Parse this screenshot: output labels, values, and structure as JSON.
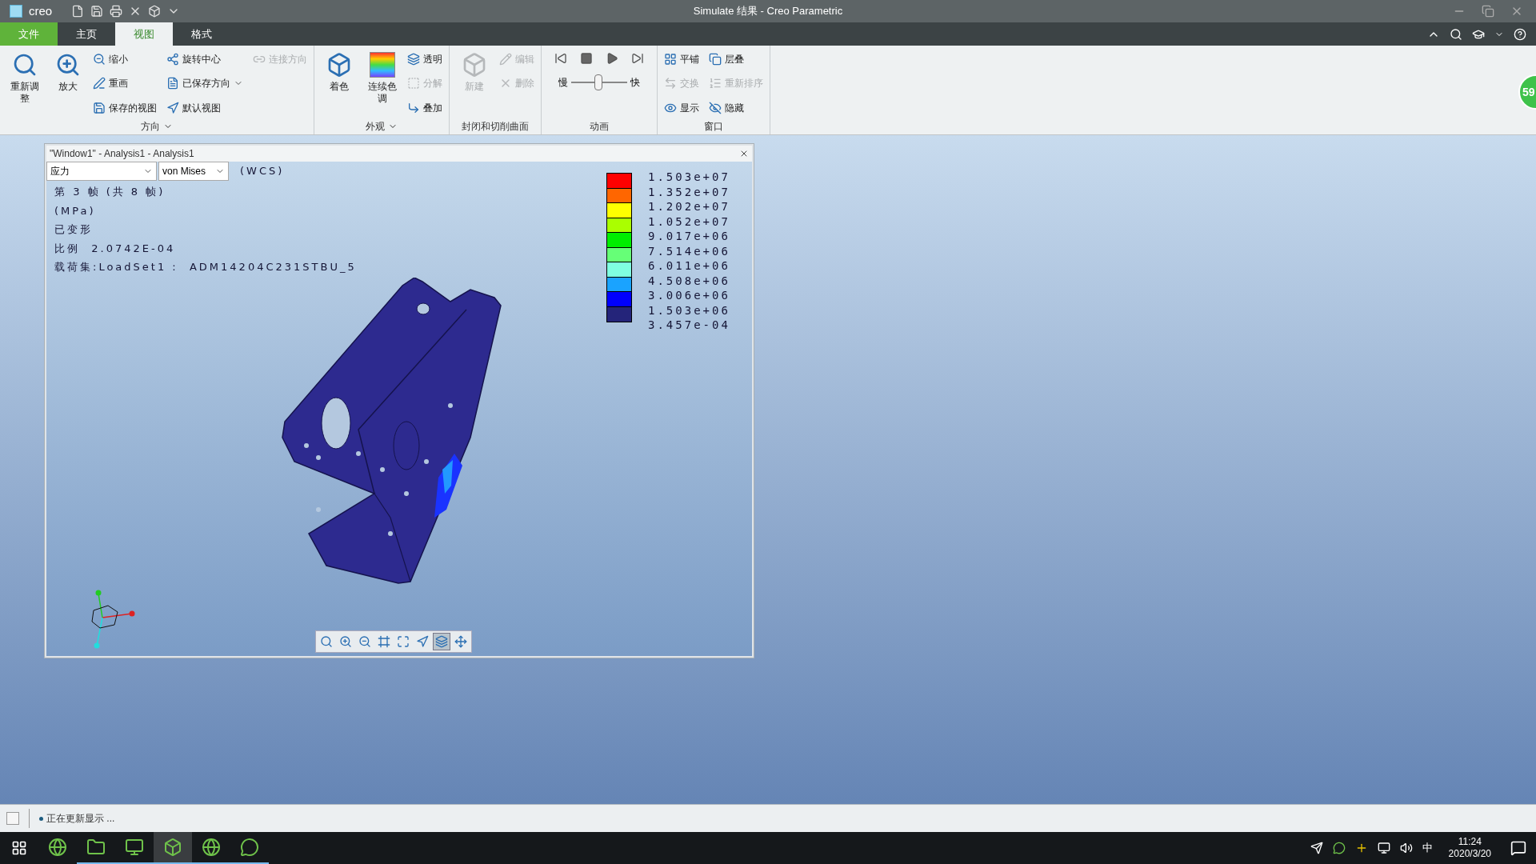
{
  "title_bar": {
    "app": "creo",
    "title": "Simulate 结果 - Creo Parametric"
  },
  "tabs": [
    {
      "label": "文件",
      "kind": "file",
      "selected": false
    },
    {
      "label": "主页",
      "kind": "tab",
      "selected": false
    },
    {
      "label": "视图",
      "kind": "tab",
      "selected": true
    },
    {
      "label": "格式",
      "kind": "tab",
      "selected": false
    }
  ],
  "ribbon_groups": [
    {
      "label": "方向",
      "dropdown": true,
      "items": [
        {
          "kind": "large",
          "label": "重新调整",
          "disabled": false
        },
        {
          "kind": "large",
          "label": "放大",
          "disabled": false
        },
        {
          "kind": "small",
          "label": "缩小",
          "disabled": false,
          "dropdown": false
        },
        {
          "kind": "small",
          "label": "重画",
          "disabled": false,
          "dropdown": false
        },
        {
          "kind": "small",
          "label": "保存的视图",
          "disabled": false,
          "dropdown": false
        },
        {
          "kind": "small",
          "label": "旋转中心",
          "disabled": false,
          "dropdown": false
        },
        {
          "kind": "small",
          "label": "已保存方向",
          "disabled": false,
          "dropdown": true
        },
        {
          "kind": "small",
          "label": "默认视图",
          "disabled": false,
          "dropdown": false
        },
        {
          "kind": "small",
          "label": "连接方向",
          "disabled": true,
          "dropdown": false
        }
      ]
    },
    {
      "label": "外观",
      "dropdown": true,
      "items": [
        {
          "kind": "large",
          "label": "着色",
          "disabled": false
        },
        {
          "kind": "large",
          "label": "连续色调",
          "disabled": false
        },
        {
          "kind": "small",
          "label": "透明",
          "disabled": false,
          "dropdown": false
        },
        {
          "kind": "small",
          "label": "分解",
          "disabled": true,
          "dropdown": false
        },
        {
          "kind": "small",
          "label": "叠加",
          "disabled": false,
          "dropdown": false
        }
      ]
    },
    {
      "label": "封闭和切削曲面",
      "dropdown": false,
      "items": [
        {
          "kind": "large",
          "label": "新建",
          "disabled": true
        },
        {
          "kind": "small",
          "label": "编辑",
          "disabled": true,
          "dropdown": false
        },
        {
          "kind": "small",
          "label": "删除",
          "disabled": true,
          "dropdown": false
        }
      ]
    },
    {
      "label": "动画",
      "dropdown": false,
      "items": [
        {
          "kind": "player",
          "slow": "慢",
          "fast": "快",
          "level": 0.48
        }
      ]
    },
    {
      "label": "窗口",
      "dropdown": false,
      "items": [
        {
          "kind": "small",
          "label": "平铺",
          "disabled": false,
          "dropdown": false
        },
        {
          "kind": "small",
          "label": "交换",
          "disabled": true,
          "dropdown": false
        },
        {
          "kind": "small",
          "label": "显示",
          "disabled": false,
          "dropdown": false
        },
        {
          "kind": "small",
          "label": "层叠",
          "disabled": false,
          "dropdown": false
        },
        {
          "kind": "small",
          "label": "重新排序",
          "disabled": true,
          "dropdown": false
        },
        {
          "kind": "small",
          "label": "隐藏",
          "disabled": false,
          "dropdown": false
        }
      ]
    }
  ],
  "badge": "59",
  "analysis_window": {
    "title": "\"Window1\" - Analysis1 - Analysis1",
    "quantity": "应力",
    "component": "von Mises",
    "coord_system": "(WCS)",
    "info_lines": [
      "第 3 帧 (共 8 帧)",
      "(MPa)",
      "已变形",
      "比例  2.0742E-04",
      "载荷集:LoadSet1 :  ADM14204C231STBU_5"
    ],
    "legend": {
      "bands": [
        {
          "color": "#ff0000"
        },
        {
          "color": "#ff6600"
        },
        {
          "color": "#ffff00"
        },
        {
          "color": "#aaff00"
        },
        {
          "color": "#00ee00"
        },
        {
          "color": "#66ff77"
        },
        {
          "color": "#7fffe0"
        },
        {
          "color": "#1aa3ff"
        },
        {
          "color": "#0000ff"
        },
        {
          "color": "#24247a"
        }
      ],
      "values": [
        "1.503e+07",
        "1.352e+07",
        "1.202e+07",
        "1.052e+07",
        "9.017e+06",
        "7.514e+06",
        "6.011e+06",
        "4.508e+06",
        "3.006e+06",
        "1.503e+06",
        "3.457e-04"
      ]
    },
    "toolbar": [
      {
        "selected": false
      },
      {
        "selected": false
      },
      {
        "selected": false
      },
      {
        "selected": false
      },
      {
        "selected": false
      },
      {
        "selected": false
      },
      {
        "selected": true
      },
      {
        "selected": false
      }
    ]
  },
  "status_bar": {
    "checked": false,
    "message": "正在更新显示 ..."
  },
  "taskbar": {
    "apps": [
      {
        "running": false,
        "selected": false
      },
      {
        "running": true,
        "selected": false
      },
      {
        "running": true,
        "selected": false
      },
      {
        "running": true,
        "selected": true
      },
      {
        "running": true,
        "selected": false
      },
      {
        "running": true,
        "selected": false
      }
    ],
    "ime": "中",
    "time": "11:24",
    "date": "2020/3/20"
  }
}
